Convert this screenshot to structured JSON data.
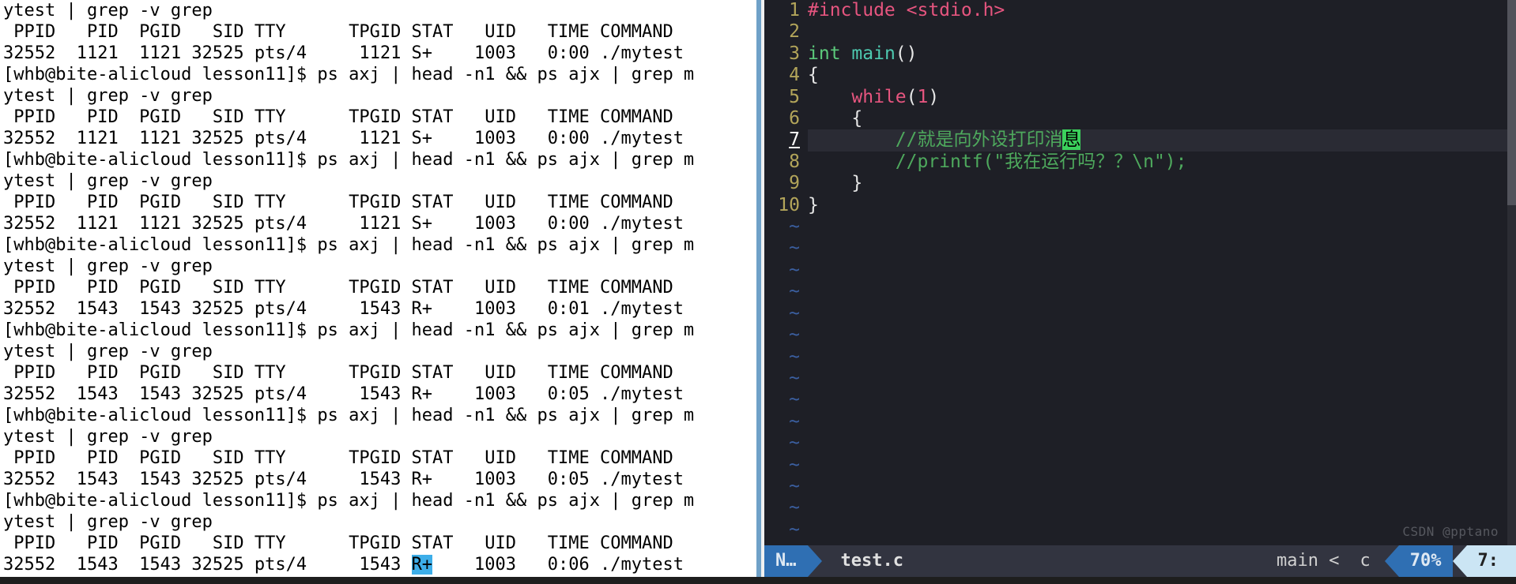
{
  "colors": {
    "accent_blue": "#2f6fb3",
    "accent_light": "#cbe5f4",
    "comment_green": "#4ea95d",
    "keyword_pink": "#e6557f"
  },
  "terminal": {
    "prompt": "[whb@bite-alicloud lesson11]$ ",
    "command": "ps axj | head -n1 && ps ajx | grep mytest | grep -v grep",
    "header": " PPID   PID  PGID   SID TTY      TPGID STAT   UID   TIME COMMAND",
    "runs": [
      {
        "ppid": "32552",
        "pid": "1121",
        "pgid": "1121",
        "sid": "32525",
        "tty": "pts/4",
        "tpgid": "1121",
        "stat": "S+",
        "uid": "1003",
        "time": "0:00",
        "cmd": "./mytest"
      },
      {
        "ppid": "32552",
        "pid": "1121",
        "pgid": "1121",
        "sid": "32525",
        "tty": "pts/4",
        "tpgid": "1121",
        "stat": "S+",
        "uid": "1003",
        "time": "0:00",
        "cmd": "./mytest"
      },
      {
        "ppid": "32552",
        "pid": "1121",
        "pgid": "1121",
        "sid": "32525",
        "tty": "pts/4",
        "tpgid": "1121",
        "stat": "S+",
        "uid": "1003",
        "time": "0:00",
        "cmd": "./mytest"
      },
      {
        "ppid": "32552",
        "pid": "1543",
        "pgid": "1543",
        "sid": "32525",
        "tty": "pts/4",
        "tpgid": "1543",
        "stat": "R+",
        "uid": "1003",
        "time": "0:01",
        "cmd": "./mytest"
      },
      {
        "ppid": "32552",
        "pid": "1543",
        "pgid": "1543",
        "sid": "32525",
        "tty": "pts/4",
        "tpgid": "1543",
        "stat": "R+",
        "uid": "1003",
        "time": "0:05",
        "cmd": "./mytest"
      },
      {
        "ppid": "32552",
        "pid": "1543",
        "pgid": "1543",
        "sid": "32525",
        "tty": "pts/4",
        "tpgid": "1543",
        "stat": "R+",
        "uid": "1003",
        "time": "0:05",
        "cmd": "./mytest"
      },
      {
        "ppid": "32552",
        "pid": "1543",
        "pgid": "1543",
        "sid": "32525",
        "tty": "pts/4",
        "tpgid": "1543",
        "stat": "R+",
        "uid": "1003",
        "time": "0:06",
        "cmd": "./mytest"
      }
    ],
    "cursor_row_index": 6
  },
  "editor": {
    "filename": "test.c",
    "filetype": "c",
    "mode": "N…",
    "func": "main",
    "percent": "70%",
    "position": "7:",
    "current_line": 7,
    "line_count": 10,
    "lines": {
      "1": {
        "pre": "#include",
        "hdr": "<stdio.h>"
      },
      "3": {
        "type": "int",
        "fn": "main",
        "tail": "()"
      },
      "4": {
        "text": "{"
      },
      "5": {
        "kw": "while",
        "arg": "1",
        "tail": ")"
      },
      "6": {
        "text": "    {"
      },
      "7": {
        "cm_prefix": "        //就是向外设打印消",
        "cm_hl": "息"
      },
      "8": {
        "cm": "        //printf(\"我在运行吗？？\\n\");"
      },
      "9": {
        "text": "    }"
      },
      "10": {
        "text": "}"
      }
    },
    "watermark": "CSDN @pptano"
  }
}
